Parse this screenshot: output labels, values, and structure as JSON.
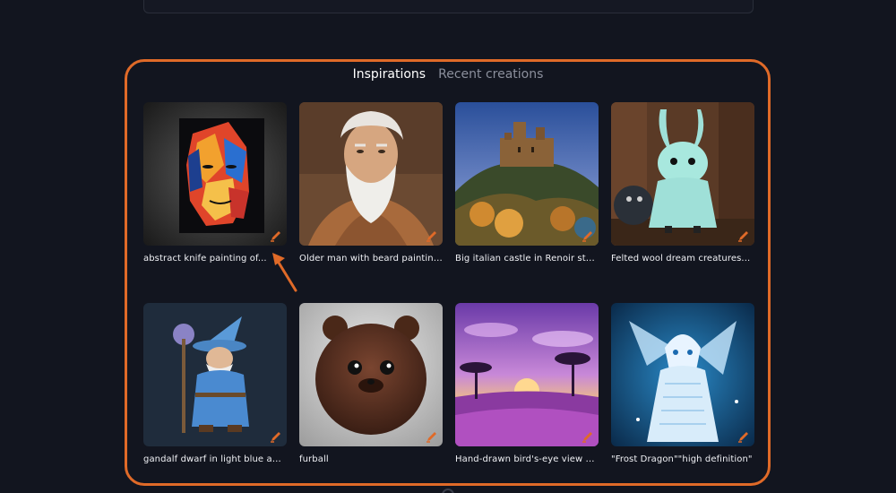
{
  "tabs": [
    {
      "label": "Inspirations",
      "active": true
    },
    {
      "label": "Recent creations",
      "active": false
    }
  ],
  "colors": {
    "accent": "#e06a28",
    "background": "#12151f",
    "tab_active": "#ffffff",
    "tab_inactive": "#8b8f9c"
  },
  "cards": [
    {
      "caption": "abstract knife painting of...",
      "image": "abstract-face-painting"
    },
    {
      "caption": "Older man with beard painting...",
      "image": "old-man-portrait"
    },
    {
      "caption": "Big italian castle in Renoir styl...",
      "image": "italian-castle-painting"
    },
    {
      "caption": "Felted wool dream creatures...",
      "image": "felted-wool-creatures"
    },
    {
      "caption": "gandalf dwarf in light blue and...",
      "image": "wizard-dwarf"
    },
    {
      "caption": "furball",
      "image": "furball-creature"
    },
    {
      "caption": "Hand-drawn bird's-eye view of...",
      "image": "purple-savanna-landscape"
    },
    {
      "caption": "\"Frost Dragon\"\"high definition\"",
      "image": "frost-dragon"
    }
  ]
}
